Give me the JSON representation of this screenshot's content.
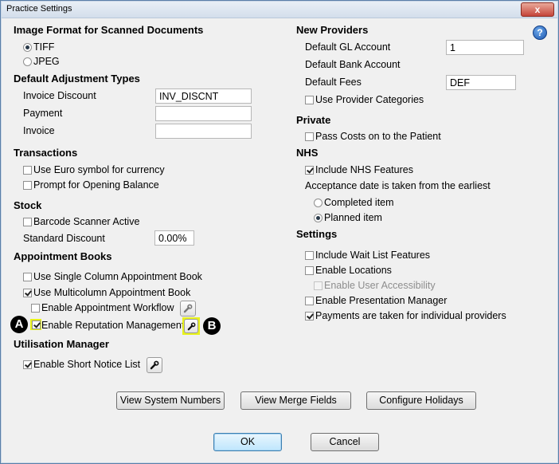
{
  "window": {
    "title": "Practice Settings",
    "close_label": "x",
    "help_label": "?"
  },
  "left": {
    "image_format": {
      "header": "Image Format for Scanned Documents",
      "tiff": "TIFF",
      "jpeg": "JPEG",
      "selected": "TIFF"
    },
    "adjustment": {
      "header": "Default Adjustment Types",
      "invoice_discount_label": "Invoice Discount",
      "invoice_discount_value": "INV_DISCNT",
      "payment_label": "Payment",
      "payment_value": "",
      "invoice_label": "Invoice",
      "invoice_value": ""
    },
    "transactions": {
      "header": "Transactions",
      "euro": "Use Euro symbol for currency",
      "opening_balance": "Prompt for Opening Balance"
    },
    "stock": {
      "header": "Stock",
      "barcode": "Barcode Scanner Active",
      "discount_label": "Standard Discount",
      "discount_value": "0.00%"
    },
    "appointment": {
      "header": "Appointment Books",
      "single": "Use Single Column Appointment Book",
      "multi": "Use Multicolumn Appointment Book",
      "workflow": "Enable Appointment Workflow",
      "reputation": "Enable Reputation Management"
    },
    "utilisation": {
      "header": "Utilisation Manager",
      "short_notice": "Enable Short Notice List"
    }
  },
  "right": {
    "new_providers": {
      "header": "New Providers",
      "gl_label": "Default GL Account",
      "gl_value": "1",
      "bank_label": "Default Bank Account",
      "fees_label": "Default Fees",
      "fees_value": "DEF",
      "categories": "Use Provider Categories"
    },
    "private": {
      "header": "Private",
      "pass_costs": "Pass Costs on to the Patient"
    },
    "nhs": {
      "header": "NHS",
      "include": "Include NHS Features",
      "acceptance": "Acceptance date is taken from the earliest",
      "completed": "Completed item",
      "planned": "Planned item",
      "selected": "Planned item"
    },
    "settings": {
      "header": "Settings",
      "wait_list": "Include Wait List Features",
      "locations": "Enable Locations",
      "user_access": "Enable User Accessibility",
      "presentation": "Enable Presentation Manager",
      "payments": "Payments are taken for individual providers"
    }
  },
  "buttons": {
    "system_numbers": "View System Numbers",
    "merge_fields": "View Merge Fields",
    "holidays": "Configure Holidays",
    "ok": "OK",
    "cancel": "Cancel"
  },
  "callouts": {
    "a": "A",
    "b": "B"
  },
  "colors": {
    "highlight": "#e8f21a",
    "window_border": "#5a7fa8",
    "background": "#f0f0f0"
  }
}
